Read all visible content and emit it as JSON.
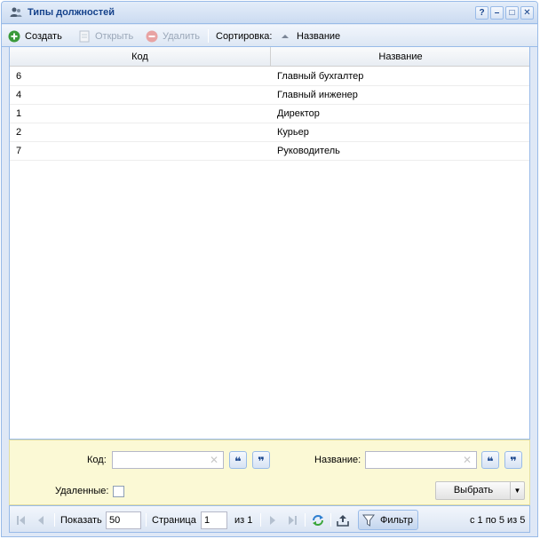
{
  "window": {
    "title": "Типы должностей",
    "tools": [
      "?",
      "–",
      "□",
      "✕"
    ]
  },
  "toolbar": {
    "create": "Создать",
    "open": "Открыть",
    "delete": "Удалить",
    "sort_label": "Сортировка:",
    "sort_field": "Название"
  },
  "grid": {
    "columns": [
      "Код",
      "Название"
    ],
    "rows": [
      {
        "code": "6",
        "name": "Главный бухгалтер"
      },
      {
        "code": "4",
        "name": "Главный инженер"
      },
      {
        "code": "1",
        "name": "Директор"
      },
      {
        "code": "2",
        "name": "Курьер"
      },
      {
        "code": "7",
        "name": "Руководитель"
      }
    ]
  },
  "filter": {
    "code_label": "Код:",
    "code_value": "",
    "name_label": "Название:",
    "name_value": "",
    "deleted_label": "Удаленные:",
    "deleted_checked": false,
    "select_label": "Выбрать"
  },
  "pager": {
    "show_label": "Показать",
    "page_size": "50",
    "page_label": "Страница",
    "page_value": "1",
    "of_label": "из 1",
    "filter_label": "Фильтр",
    "summary": "с 1 по 5 из 5"
  },
  "colors": {
    "accent": "#15428b",
    "border": "#99bbe8",
    "create_green": "#3a9a3a",
    "filter_bg": "#fbf9d5"
  }
}
